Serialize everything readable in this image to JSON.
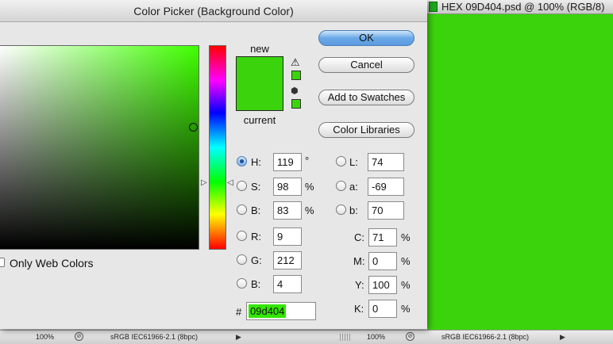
{
  "dialog": {
    "title": "Color Picker (Background Color)",
    "only_web_colors_label": "Only Web Colors",
    "new_label": "new",
    "current_label": "current",
    "new_color": "#3bd40c",
    "current_color": "#3bd40c",
    "buttons": {
      "ok": "OK",
      "cancel": "Cancel",
      "add_to_swatches": "Add to Swatches",
      "color_libraries": "Color Libraries"
    },
    "hsb": {
      "h": {
        "label": "H:",
        "value": "119",
        "unit": "°",
        "selected": true
      },
      "s": {
        "label": "S:",
        "value": "98",
        "unit": "%"
      },
      "b": {
        "label": "B:",
        "value": "83",
        "unit": "%"
      }
    },
    "lab": {
      "l": {
        "label": "L:",
        "value": "74"
      },
      "a": {
        "label": "a:",
        "value": "-69"
      },
      "b": {
        "label": "b:",
        "value": "70"
      }
    },
    "rgb": {
      "r": {
        "label": "R:",
        "value": "9"
      },
      "g": {
        "label": "G:",
        "value": "212"
      },
      "b": {
        "label": "B:",
        "value": "4"
      }
    },
    "cmyk": {
      "c": {
        "label": "C:",
        "value": "71",
        "unit": "%"
      },
      "m": {
        "label": "M:",
        "value": "0",
        "unit": "%"
      },
      "y": {
        "label": "Y:",
        "value": "100",
        "unit": "%"
      },
      "k": {
        "label": "K:",
        "value": "0",
        "unit": "%"
      }
    },
    "hex": {
      "label": "#",
      "value": "09d404"
    }
  },
  "document": {
    "title": "HEX 09D404.psd @ 100% (RGB/8)",
    "canvas_color": "#3bd40c"
  },
  "statusbar": {
    "left": {
      "zoom": "100%",
      "profile": "sRGB IEC61966-2.1 (8bpc)"
    },
    "right": {
      "zoom": "100%",
      "profile": "sRGB IEC61966-2.1 (8bpc)"
    }
  }
}
